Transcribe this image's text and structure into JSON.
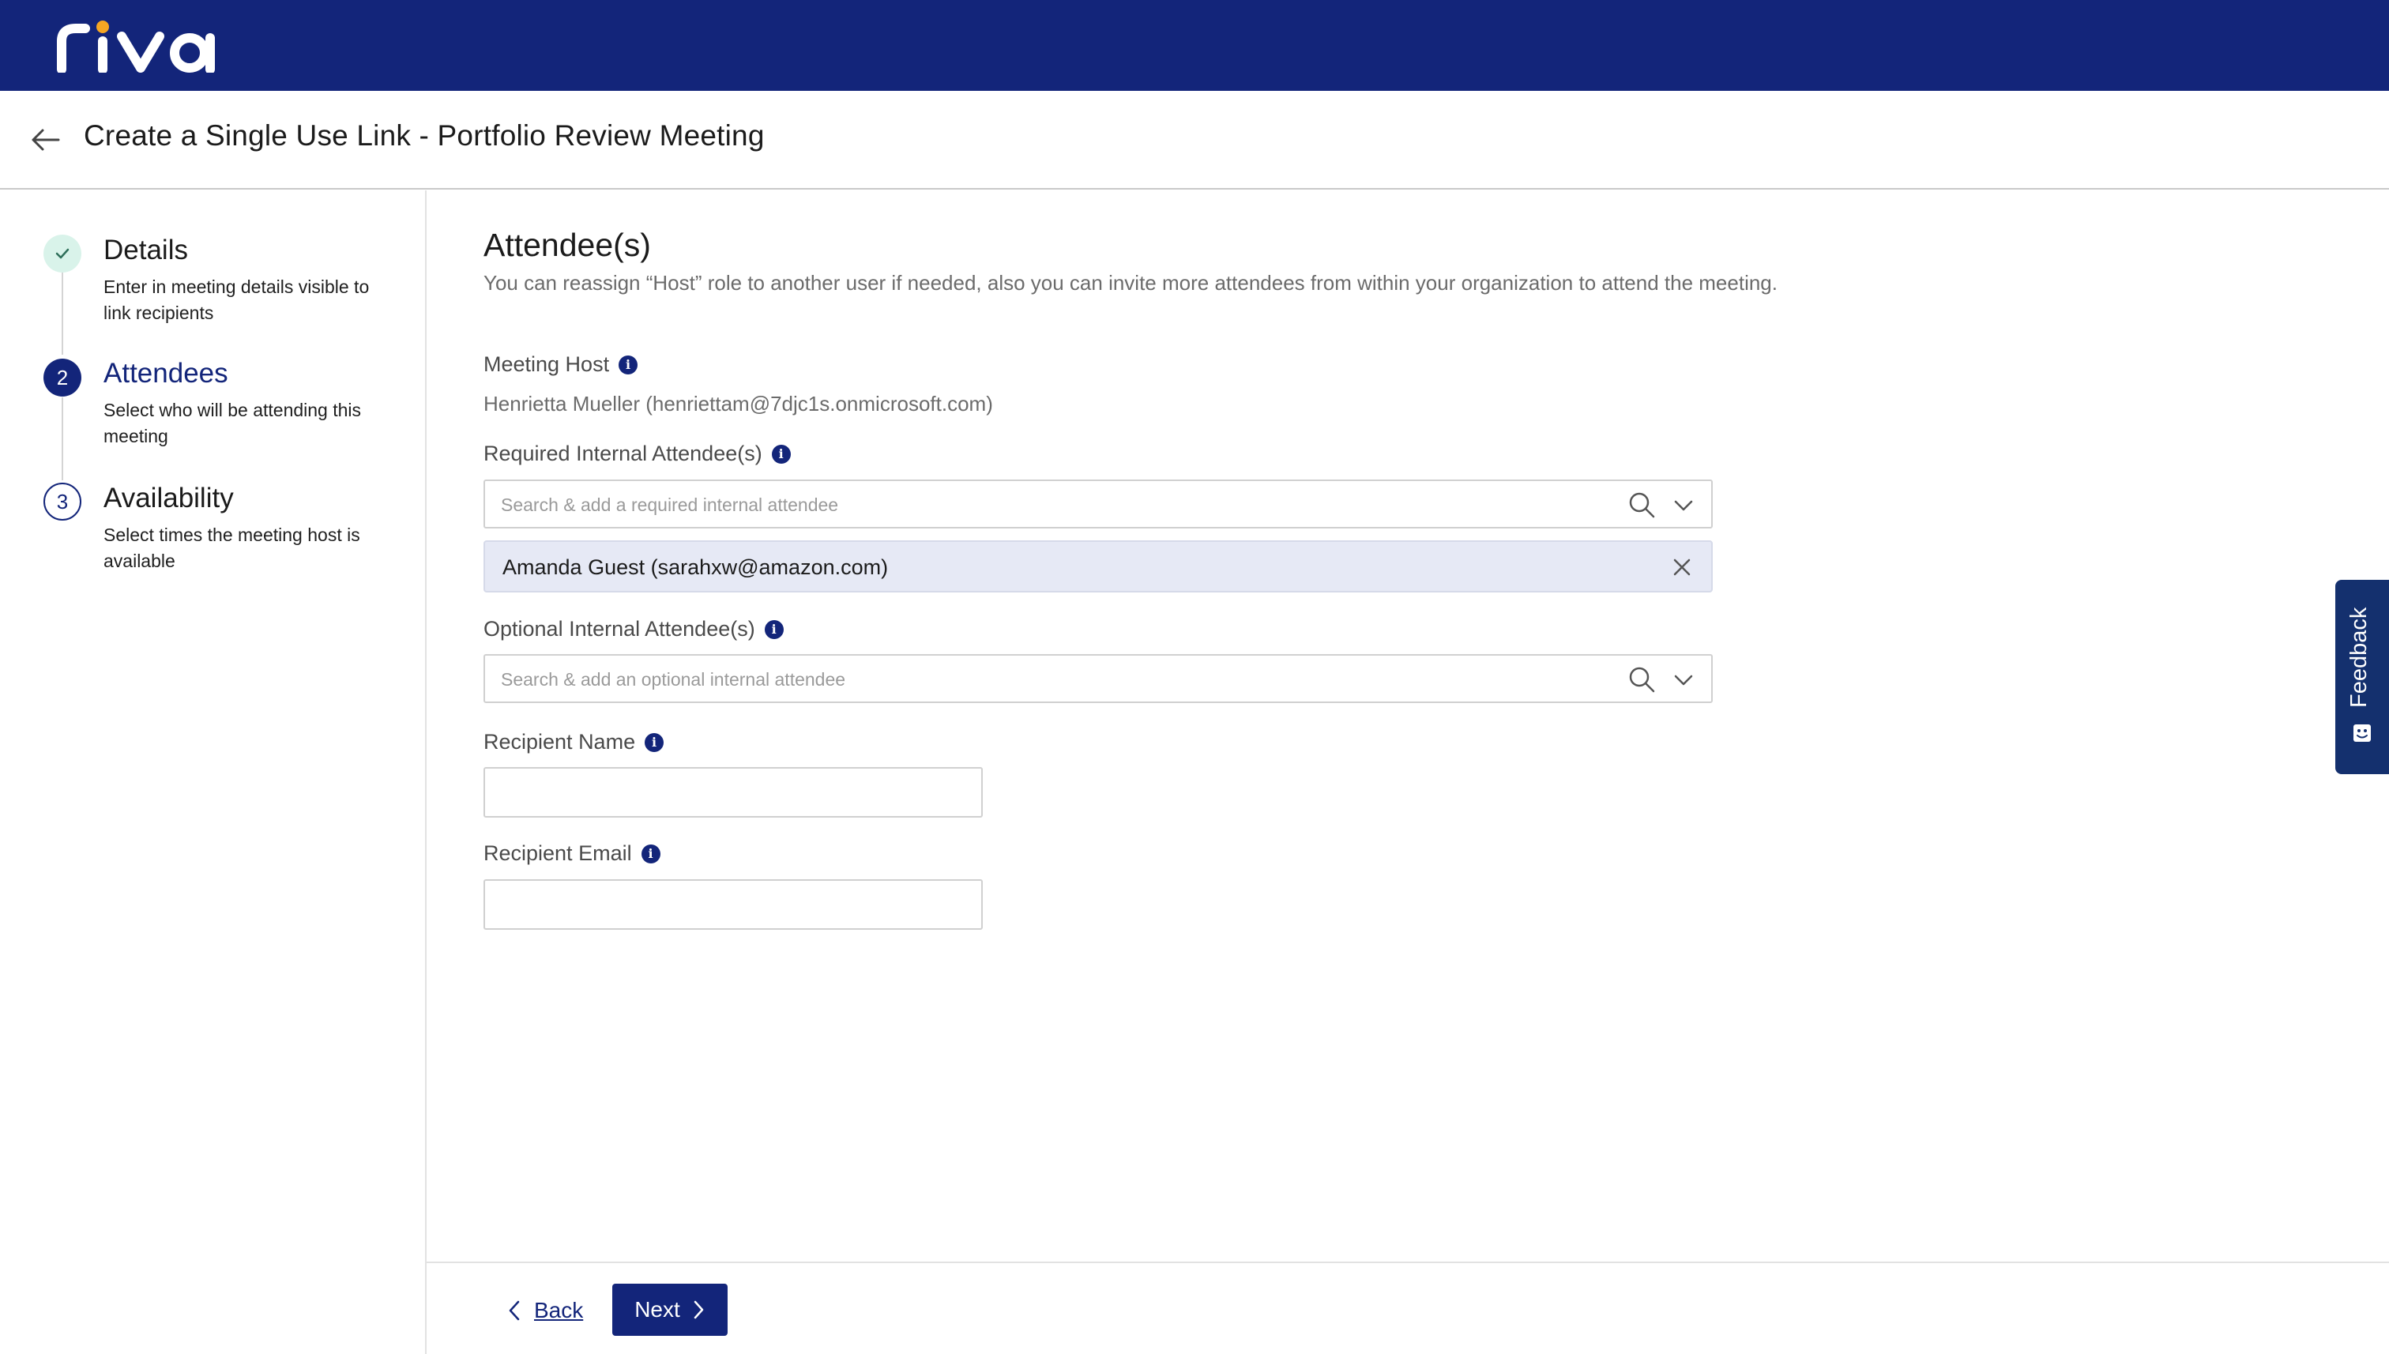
{
  "app": {
    "logo_text": "riva",
    "brand_color": "#13257a",
    "accent_color": "#f5a623"
  },
  "header": {
    "title": "Create a Single Use Link - Portfolio Review Meeting",
    "back_icon": "arrow-left-icon"
  },
  "steps": [
    {
      "number": "",
      "status": "completed",
      "icon": "check-icon",
      "title": "Details",
      "description": "Enter in meeting details visible to link recipients"
    },
    {
      "number": "2",
      "status": "active",
      "title": "Attendees",
      "description": "Select who will be attending this meeting"
    },
    {
      "number": "3",
      "status": "upcoming",
      "title": "Availability",
      "description": "Select times the meeting host is available"
    }
  ],
  "main": {
    "title": "Attendee(s)",
    "description": "You can reassign “Host” role to another user if needed, also you can invite more attendees from within your organization to attend the meeting.",
    "meeting_host": {
      "label": "Meeting Host",
      "value": "Henrietta Mueller (henriettam@7djc1s.onmicrosoft.com)"
    },
    "required": {
      "label": "Required Internal Attendee(s)",
      "placeholder": "Search & add a required internal attendee",
      "selected": [
        "Amanda Guest (sarahxw@amazon.com)"
      ]
    },
    "optional": {
      "label": "Optional Internal Attendee(s)",
      "placeholder": "Search & add an optional internal attendee"
    },
    "recipient_name": {
      "label": "Recipient Name",
      "value": ""
    },
    "recipient_email": {
      "label": "Recipient Email",
      "value": ""
    }
  },
  "footer": {
    "back_label": "Back",
    "next_label": "Next"
  },
  "feedback": {
    "label": "Feedback",
    "icon": "smiley-icon"
  }
}
